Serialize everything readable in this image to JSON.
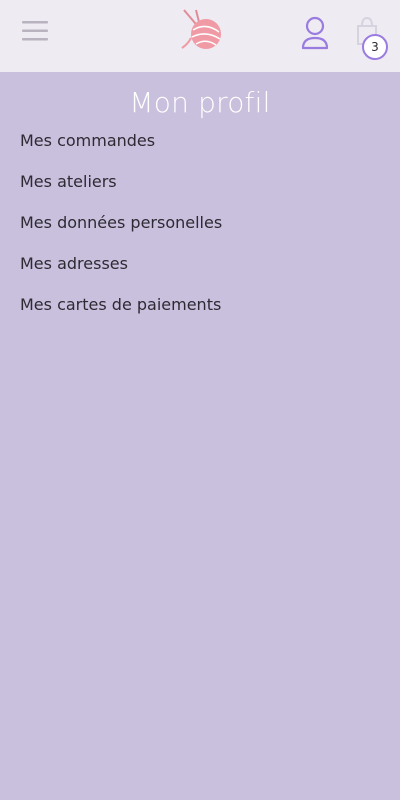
{
  "header": {
    "cart_count": "3"
  },
  "profile": {
    "title": "Mon profil",
    "menu_items": [
      "Mes commandes",
      "Mes ateliers",
      "Mes données personelles",
      "Mes adresses",
      "Mes cartes de paiements"
    ]
  },
  "colors": {
    "header_background": "#eeebf3",
    "page_background": "#c9c0dd",
    "accent": "#9a7be0",
    "logo_pink": "#f09aa5"
  },
  "icons": {
    "menu": "hamburger-icon",
    "logo": "yarn-ball-logo",
    "profile": "user-icon",
    "cart": "shopping-bag-icon"
  }
}
